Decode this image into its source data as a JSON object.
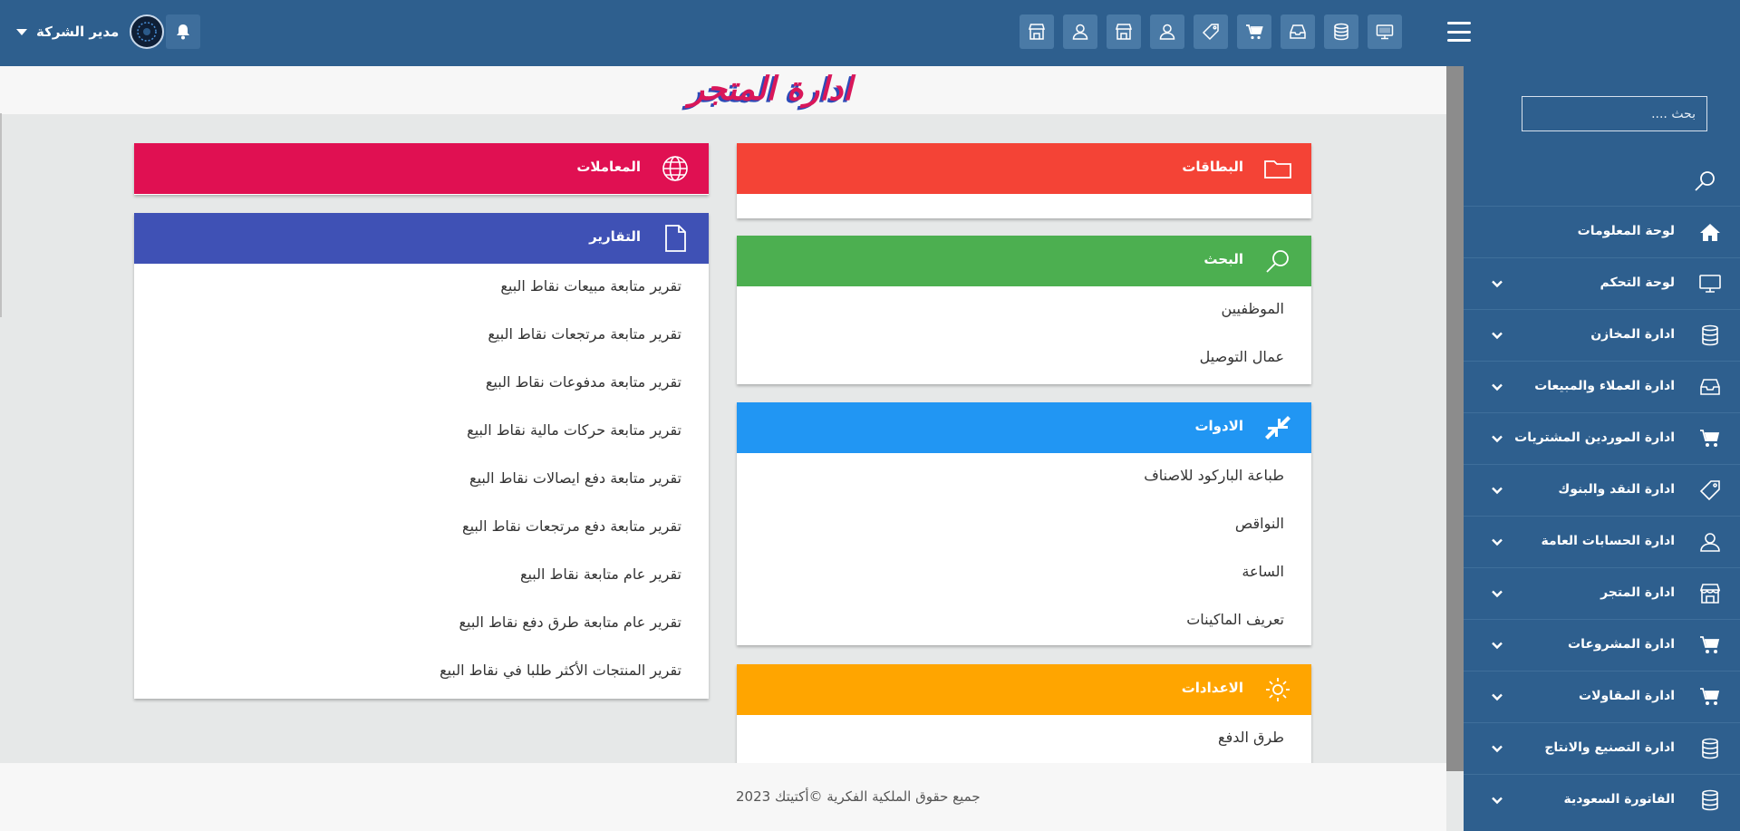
{
  "topbar": {
    "user_name": "مدير الشركة",
    "icons": [
      "store-icon",
      "user-icon",
      "store-icon",
      "user-icon",
      "tag-icon",
      "cart-icon",
      "inbox-icon",
      "database-icon",
      "monitor-icon"
    ]
  },
  "sidebar": {
    "search_placeholder": "بحث ....",
    "items": [
      {
        "label": "لوحة المعلومات",
        "icon": "home-icon",
        "has_submenu": false
      },
      {
        "label": "لوحة التحكم",
        "icon": "monitor-icon",
        "has_submenu": true
      },
      {
        "label": "ادارة المخازن",
        "icon": "database-icon",
        "has_submenu": true
      },
      {
        "label": "ادارة العملاء والمبيعات",
        "icon": "inbox-icon",
        "has_submenu": true
      },
      {
        "label": "ادارة الموردين المشتريات",
        "icon": "cart-icon",
        "has_submenu": true
      },
      {
        "label": "ادارة النقد والبنوك",
        "icon": "tag-icon",
        "has_submenu": true
      },
      {
        "label": "ادارة الحسابات العامة",
        "icon": "user-icon",
        "has_submenu": true
      },
      {
        "label": "ادارة المتجر",
        "icon": "store-icon",
        "has_submenu": true
      },
      {
        "label": "ادارة المشروعات",
        "icon": "cart-icon",
        "has_submenu": true
      },
      {
        "label": "ادارة المقاولات",
        "icon": "cart-icon",
        "has_submenu": true
      },
      {
        "label": "ادارة التصنيع والانتاج",
        "icon": "database-icon",
        "has_submenu": true
      },
      {
        "label": "الفاتورة السعودية",
        "icon": "database-icon",
        "has_submenu": true
      }
    ]
  },
  "page": {
    "title": "ادارة المتجر"
  },
  "panels": {
    "cards": {
      "title": "البطاقات",
      "color": "#f44336",
      "items": []
    },
    "search": {
      "title": "البحث",
      "color": "#4caf50",
      "items": [
        "الموظفيين",
        "عمال التوصيل"
      ]
    },
    "tools": {
      "title": "الادوات",
      "color": "#2196f3",
      "items": [
        "طباعة الباركود للاصناف",
        "النواقص",
        "الساعة",
        "تعريف الماكينات"
      ]
    },
    "settings": {
      "title": "الاعدادات",
      "color": "#ffa500",
      "items": [
        "طرق الدفع"
      ]
    },
    "transactions": {
      "title": "المعاملات",
      "color": "#e01052",
      "items": []
    },
    "reports": {
      "title": "التقارير",
      "color": "#3f51b5",
      "items": [
        "تقرير متابعة مبيعات نقاط البيع",
        "تقرير متابعة مرتجعات نقاط البيع",
        "تقرير متابعة مدفوعات نقاط البيع",
        "تقرير متابعة حركات مالية نقاط البيع",
        "تقرير متابعة دفع ايصالات نقاط البيع",
        "تقرير متابعة دفع مرتجعات نقاط البيع",
        "تقرير عام متابعة نقاط البيع",
        "تقرير عام متابعة طرق دفع نقاط البيع",
        "تقرير المنتجات الأكثر طلبا في نقاط البيع"
      ]
    }
  },
  "footer": {
    "text": "جميع حقوق الملكية الفكرية ©أكتيتك 2023"
  }
}
